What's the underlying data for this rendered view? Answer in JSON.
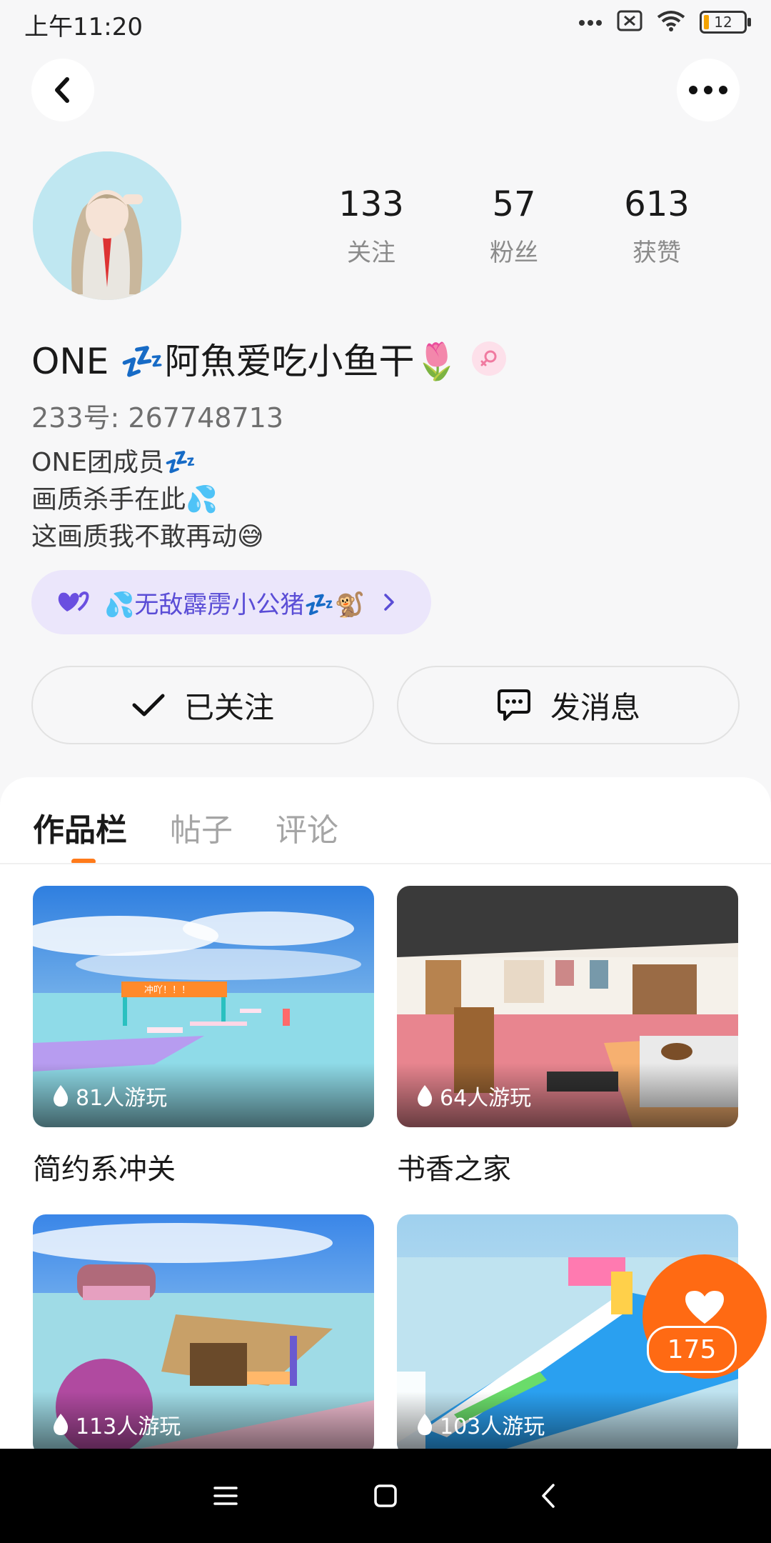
{
  "status": {
    "time": "上午11:20",
    "battery": "12"
  },
  "profile": {
    "stats": [
      {
        "num": "133",
        "label": "关注"
      },
      {
        "num": "57",
        "label": "粉丝"
      },
      {
        "num": "613",
        "label": "获赞"
      }
    ],
    "name": "ONE 💤阿魚爱吃小鱼干🌷",
    "uid": "233号: 267748713",
    "bio": [
      "ONE团成员💤",
      "画质杀手在此💦",
      "这画质我不敢再动😅"
    ],
    "family": "💦无敌霹雳小公猪💤🐒"
  },
  "actions": {
    "follow": "已关注",
    "message": "发消息"
  },
  "tabs": [
    "作品栏",
    "帖子",
    "评论"
  ],
  "games": [
    {
      "plays": "81人游玩",
      "title": "简约系冲关"
    },
    {
      "plays": "64人游玩",
      "title": "书香之家"
    },
    {
      "plays": "113人游玩",
      "title": ""
    },
    {
      "plays": "103人游玩",
      "title": ""
    }
  ],
  "game1_sign": "冲吖！！！",
  "like_count": "175",
  "colors": {
    "accent": "#ff6a13",
    "family_text": "#5a4dd6"
  }
}
